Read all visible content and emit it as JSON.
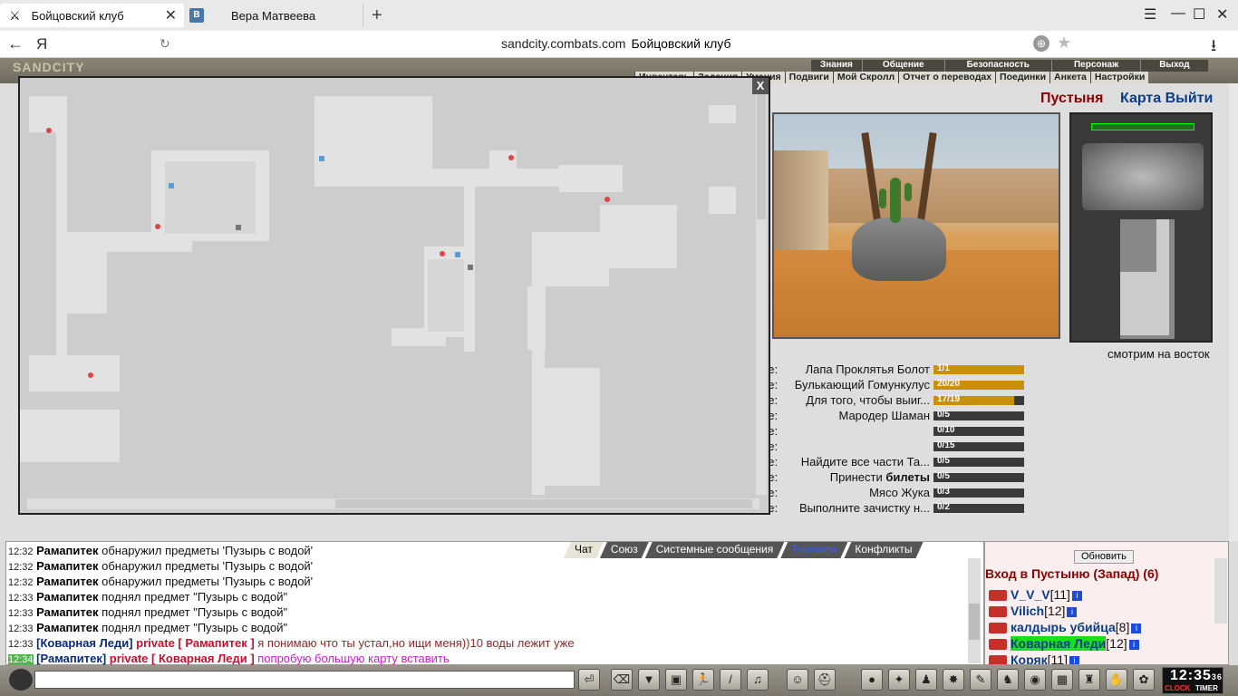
{
  "browser": {
    "tabs": [
      {
        "label": "Бойцовский клуб",
        "close": "✕"
      },
      {
        "label": "Вера Матвеева",
        "icon_text": "В"
      }
    ],
    "new_tab": "+",
    "url": "sandcity.combats.com",
    "page_title": "Бойцовский клуб",
    "ya": "Я"
  },
  "game": {
    "logo": "SANDCITY",
    "topnav": [
      "Знания",
      "Общение",
      "Безопасность",
      "Персонаж",
      "Выход"
    ],
    "subnav": [
      "Инвентарь",
      "Задания",
      "Умения",
      "Подвиги",
      "Мой Скролл",
      "Отчет о переводах",
      "Поединки",
      "Анкета",
      "Настройки"
    ],
    "location": "Пустыня",
    "map_link": "Карта Выйти",
    "facing": "смотрим на восток",
    "quest_prefix": "ие:",
    "quests": [
      {
        "label": "Лапа Проклятья Болот",
        "bold": "",
        "value": "1/1",
        "fraction": 1.0
      },
      {
        "label": "Булькающий Гомункулус",
        "bold": "",
        "value": "20/20",
        "fraction": 1.0
      },
      {
        "label": "Для того, чтобы выиг...",
        "bold": "",
        "value": "17/19",
        "fraction": 0.89
      },
      {
        "label": "Мародер Шаман",
        "bold": "",
        "value": "0/5",
        "fraction": 0
      },
      {
        "label": "",
        "bold": "",
        "value": "0/10",
        "fraction": 0
      },
      {
        "label": "",
        "bold": "",
        "value": "0/15",
        "fraction": 0
      },
      {
        "label": "Найдите все части Та...",
        "bold": "",
        "value": "0/5",
        "fraction": 0
      },
      {
        "label": "Принести ",
        "bold": "билеты",
        "value": "0/5",
        "fraction": 0
      },
      {
        "label": "Мясо Жука",
        "bold": "",
        "value": "0/3",
        "fraction": 0
      },
      {
        "label": "Выполните зачистку н...",
        "bold": "",
        "value": "0/2",
        "fraction": 0
      }
    ],
    "map_close": "X"
  },
  "chat": {
    "tabs": [
      "Чат",
      "Союз",
      "Системные сообщения",
      "Торговля",
      "Конфликты"
    ],
    "lines": [
      {
        "time": "12:32",
        "name": "Рамапитек",
        "text": " обнаружил предметы 'Пузырь с водой'"
      },
      {
        "time": "12:32",
        "name": "Рамапитек",
        "text": " обнаружил предметы 'Пузырь с водой'"
      },
      {
        "time": "12:32",
        "name": "Рамапитек",
        "text": " обнаружил предметы 'Пузырь с водой'"
      },
      {
        "time": "12:33",
        "name": "Рамапитек",
        "text": " поднял предмет \"Пузырь с водой\""
      },
      {
        "time": "12:33",
        "name": "Рамапитек",
        "text": " поднял предмет \"Пузырь с водой\""
      },
      {
        "time": "12:33",
        "name": "Рамапитек",
        "text": " поднял предмет \"Пузырь с водой\""
      }
    ],
    "private1": {
      "time": "12:33",
      "from": "[Коварная Леди]",
      "tag": " private [ Рамапитек ] ",
      "text": "я понимаю что ты устал,но ищи меня))10 воды лежит уже"
    },
    "private2": {
      "time": "12:34",
      "from": "[Рамапитек]",
      "tag": " private [ Коварная Леди ] ",
      "text": "попробую большую карту вставить"
    }
  },
  "users": {
    "refresh": "Обновить",
    "room": "Вход в Пустыню (Запад) (6)",
    "list": [
      {
        "name": "V_V_V",
        "level": "[11]"
      },
      {
        "name": "Vilich",
        "level": "[12]"
      },
      {
        "name": "калдырь убийца",
        "level": "[8]"
      },
      {
        "name": "Коварная Леди",
        "level": "[12]"
      },
      {
        "name": "Коряк",
        "level": "[11]"
      }
    ]
  },
  "clock": {
    "time": "12:35",
    "seconds": "36",
    "clock_label": "CLOCK",
    "timer_label": "TIMER"
  }
}
